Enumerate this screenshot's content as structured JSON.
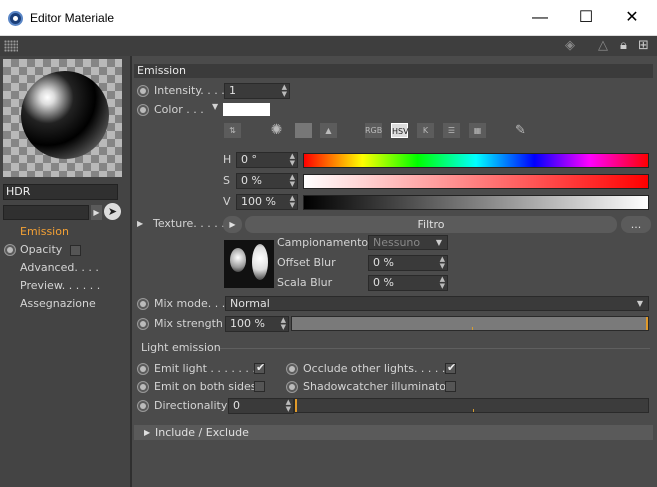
{
  "window": {
    "title": "Editor Materiale",
    "minimize_glyph": "—",
    "maximize_glyph": "☐",
    "close_glyph": "✕"
  },
  "left_panel": {
    "material_name": "HDR",
    "channels": [
      {
        "label": "Emission",
        "active": true,
        "has_radio": false,
        "has_checkbox": false
      },
      {
        "label": "Opacity",
        "active": false,
        "has_radio": true,
        "has_checkbox": true
      },
      {
        "label": "Advanced. . . .",
        "active": false,
        "has_radio": false,
        "has_checkbox": false
      },
      {
        "label": "Preview. . . . . .",
        "active": false,
        "has_radio": false,
        "has_checkbox": false
      },
      {
        "label": "Assegnazione",
        "active": false,
        "has_radio": false,
        "has_checkbox": false
      }
    ]
  },
  "emission": {
    "section_title": "Emission",
    "intensity_label": "Intensity. . . .",
    "intensity_value": "1",
    "color_label": "Color . . .",
    "color_value": "#ffffff",
    "color_mode_buttons": [
      "RGB",
      "HSV",
      "K"
    ],
    "selected_color_mode": "HSV",
    "h_label": "H",
    "h_value": "0 °",
    "s_label": "S",
    "s_value": "0 %",
    "v_label": "V",
    "v_value": "100 %",
    "texture_label": "Texture. . . . .",
    "texture_button": "Filtro",
    "texture_more": "...",
    "sampling_label": "Campionamento",
    "sampling_value": "Nessuno",
    "offset_blur_label": "Offset Blur",
    "offset_blur_value": "0 %",
    "scale_blur_label": "Scala Blur",
    "scale_blur_value": "0 %",
    "mix_mode_label": "Mix mode. . .",
    "mix_mode_value": "Normal",
    "mix_strength_label": "Mix strength",
    "mix_strength_value": "100 %",
    "mix_strength_fraction": 1.0
  },
  "light_emission": {
    "group_title": "Light emission",
    "emit_light_label": "Emit light . . . . . . . .",
    "emit_light_checked": true,
    "occlude_label": "Occlude other lights. . . . . .",
    "occlude_checked": true,
    "emit_both_label": "Emit on both sides",
    "emit_both_checked": false,
    "shadowcatcher_label": "Shadowcatcher illuminator",
    "shadowcatcher_checked": false,
    "directionality_label": "Directionality",
    "directionality_value": "0",
    "directionality_fraction": 0.0,
    "include_exclude_label": "Include / Exclude"
  }
}
